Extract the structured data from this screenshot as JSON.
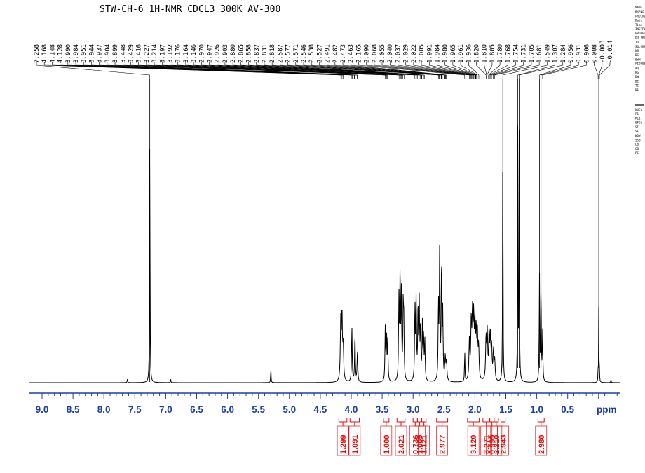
{
  "chart_data": {
    "type": "line",
    "title": "STW-CH-6 1H-NMR CDCL3 300K AV-300",
    "xlabel": "ppm",
    "x_reversed": true,
    "xlim": [
      9.0,
      0.0
    ],
    "x_ticks": [
      "9.0",
      "8.5",
      "8.0",
      "7.5",
      "7.0",
      "6.5",
      "6.0",
      "5.5",
      "5.0",
      "4.5",
      "4.0",
      "3.5",
      "3.0",
      "2.5",
      "2.0",
      "1.5",
      "1.0",
      "0.5"
    ],
    "peak_labels": [
      "7.258",
      "4.168",
      "4.148",
      "4.128",
      "3.990",
      "3.984",
      "3.951",
      "3.944",
      "3.937",
      "3.904",
      "3.899",
      "3.448",
      "3.429",
      "3.416",
      "3.227",
      "3.214",
      "3.197",
      "3.192",
      "3.176",
      "3.164",
      "3.146",
      "2.970",
      "2.947",
      "2.926",
      "2.903",
      "2.880",
      "2.865",
      "2.858",
      "2.837",
      "2.831",
      "2.818",
      "2.587",
      "2.577",
      "2.571",
      "2.546",
      "2.538",
      "2.527",
      "2.491",
      "2.482",
      "2.473",
      "2.463",
      "2.165",
      "2.090",
      "2.068",
      "2.055",
      "2.040",
      "2.037",
      "2.029",
      "2.022",
      "2.005",
      "1.991",
      "1.984",
      "1.980",
      "1.965",
      "1.961",
      "1.936",
      "1.820",
      "1.810",
      "1.805",
      "1.780",
      "1.768",
      "1.754",
      "1.731",
      "1.705",
      "1.681",
      "1.549",
      "1.307",
      "1.284",
      "0.956",
      "0.931",
      "0.906",
      "0.008",
      "-0.003",
      "-0.014"
    ],
    "peaks": [
      {
        "ppm": 7.258,
        "height": 0.83,
        "width": 0.004
      },
      {
        "ppm": 7.62,
        "height": 0.012,
        "width": 0.004
      },
      {
        "ppm": 6.92,
        "height": 0.01,
        "width": 0.004
      },
      {
        "ppm": 5.3,
        "height": 0.045,
        "width": 0.004
      },
      {
        "ppm": 4.17,
        "height": 0.18,
        "width": 0.008
      },
      {
        "ppm": 4.15,
        "height": 0.2,
        "width": 0.008
      },
      {
        "ppm": 4.13,
        "height": 0.1,
        "width": 0.008
      },
      {
        "ppm": 3.99,
        "height": 0.17,
        "width": 0.006
      },
      {
        "ppm": 3.94,
        "height": 0.15,
        "width": 0.006
      },
      {
        "ppm": 3.9,
        "height": 0.1,
        "width": 0.006
      },
      {
        "ppm": 3.45,
        "height": 0.16,
        "width": 0.006
      },
      {
        "ppm": 3.43,
        "height": 0.15,
        "width": 0.006
      },
      {
        "ppm": 3.41,
        "height": 0.12,
        "width": 0.006
      },
      {
        "ppm": 3.23,
        "height": 0.25,
        "width": 0.006
      },
      {
        "ppm": 3.21,
        "height": 0.33,
        "width": 0.006
      },
      {
        "ppm": 3.19,
        "height": 0.26,
        "width": 0.006
      },
      {
        "ppm": 3.16,
        "height": 0.22,
        "width": 0.006
      },
      {
        "ppm": 3.15,
        "height": 0.16,
        "width": 0.006
      },
      {
        "ppm": 2.97,
        "height": 0.23,
        "width": 0.006
      },
      {
        "ppm": 2.95,
        "height": 0.25,
        "width": 0.006
      },
      {
        "ppm": 2.92,
        "height": 0.23,
        "width": 0.006
      },
      {
        "ppm": 2.9,
        "height": 0.23,
        "width": 0.006
      },
      {
        "ppm": 2.88,
        "height": 0.17,
        "width": 0.006
      },
      {
        "ppm": 2.85,
        "height": 0.17,
        "width": 0.006
      },
      {
        "ppm": 2.83,
        "height": 0.14,
        "width": 0.006
      },
      {
        "ppm": 2.81,
        "height": 0.12,
        "width": 0.006
      },
      {
        "ppm": 2.59,
        "height": 0.23,
        "width": 0.006
      },
      {
        "ppm": 2.57,
        "height": 0.4,
        "width": 0.006
      },
      {
        "ppm": 2.54,
        "height": 0.37,
        "width": 0.006
      },
      {
        "ppm": 2.52,
        "height": 0.2,
        "width": 0.006
      },
      {
        "ppm": 2.48,
        "height": 0.07,
        "width": 0.008
      },
      {
        "ppm": 2.46,
        "height": 0.06,
        "width": 0.008
      },
      {
        "ppm": 2.165,
        "height": 0.1,
        "width": 0.004
      },
      {
        "ppm": 2.09,
        "height": 0.12,
        "width": 0.008
      },
      {
        "ppm": 2.06,
        "height": 0.17,
        "width": 0.008
      },
      {
        "ppm": 2.04,
        "height": 0.19,
        "width": 0.008
      },
      {
        "ppm": 2.02,
        "height": 0.18,
        "width": 0.008
      },
      {
        "ppm": 2.0,
        "height": 0.15,
        "width": 0.008
      },
      {
        "ppm": 1.98,
        "height": 0.14,
        "width": 0.008
      },
      {
        "ppm": 1.96,
        "height": 0.13,
        "width": 0.008
      },
      {
        "ppm": 1.94,
        "height": 0.1,
        "width": 0.008
      },
      {
        "ppm": 1.82,
        "height": 0.13,
        "width": 0.008
      },
      {
        "ppm": 1.8,
        "height": 0.14,
        "width": 0.008
      },
      {
        "ppm": 1.77,
        "height": 0.14,
        "width": 0.008
      },
      {
        "ppm": 1.75,
        "height": 0.12,
        "width": 0.008
      },
      {
        "ppm": 1.73,
        "height": 0.1,
        "width": 0.008
      },
      {
        "ppm": 1.7,
        "height": 0.09,
        "width": 0.008
      },
      {
        "ppm": 1.68,
        "height": 0.06,
        "width": 0.008
      },
      {
        "ppm": 1.549,
        "height": 0.8,
        "width": 0.004
      },
      {
        "ppm": 1.307,
        "height": 0.76,
        "width": 0.004
      },
      {
        "ppm": 1.284,
        "height": 0.76,
        "width": 0.004
      },
      {
        "ppm": 0.956,
        "height": 0.32,
        "width": 0.005
      },
      {
        "ppm": 0.931,
        "height": 0.3,
        "width": 0.005
      },
      {
        "ppm": 0.906,
        "height": 0.16,
        "width": 0.005
      },
      {
        "ppm": 0.008,
        "height": 0.03,
        "width": 0.003
      },
      {
        "ppm": -0.003,
        "height": 0.24,
        "width": 0.003
      },
      {
        "ppm": -0.014,
        "height": 0.03,
        "width": 0.003
      },
      {
        "ppm": -0.2,
        "height": 0.01,
        "width": 0.004
      }
    ],
    "integrals": [
      {
        "label": "1.299",
        "from": 4.2,
        "to": 4.07
      },
      {
        "label": "1.091",
        "from": 4.02,
        "to": 3.87
      },
      {
        "label": "1.000",
        "from": 3.48,
        "to": 3.39
      },
      {
        "label": "2.021",
        "from": 3.26,
        "to": 3.13
      },
      {
        "label": "0.736",
        "from": 3.0,
        "to": 2.93
      },
      {
        "label": "1.009",
        "from": 2.93,
        "to": 2.86
      },
      {
        "label": "1.121",
        "from": 2.86,
        "to": 2.79
      },
      {
        "label": "2.977",
        "from": 2.62,
        "to": 2.44
      },
      {
        "label": "3.120",
        "from": 2.12,
        "to": 1.93
      },
      {
        "label": "3.271",
        "from": 1.87,
        "to": 1.76
      },
      {
        "label": "0.999",
        "from": 1.76,
        "to": 1.69
      },
      {
        "label": "2.210",
        "from": 1.69,
        "to": 1.62
      },
      {
        "label": "2.943",
        "from": 1.58,
        "to": 1.51
      },
      {
        "label": "2.980",
        "from": 0.98,
        "to": 0.88
      }
    ]
  },
  "params": {
    "col1": [
      "NAME",
      "EXPNO",
      "PROCNO",
      "Date_",
      "Time",
      "INSTRUM",
      "PROBHD",
      "PULPROG",
      "TD",
      "SOLVENT",
      "NS",
      "DS",
      "SWH",
      "FIDRES",
      "AQ",
      "RG",
      "DW",
      "DE",
      "TE",
      "D1"
    ],
    "col2": [
      "NUC1",
      "P1",
      "PL1",
      "SFO1",
      "SI",
      "SF",
      "WDW",
      "SSB",
      "LB",
      "GB",
      "PC"
    ]
  }
}
